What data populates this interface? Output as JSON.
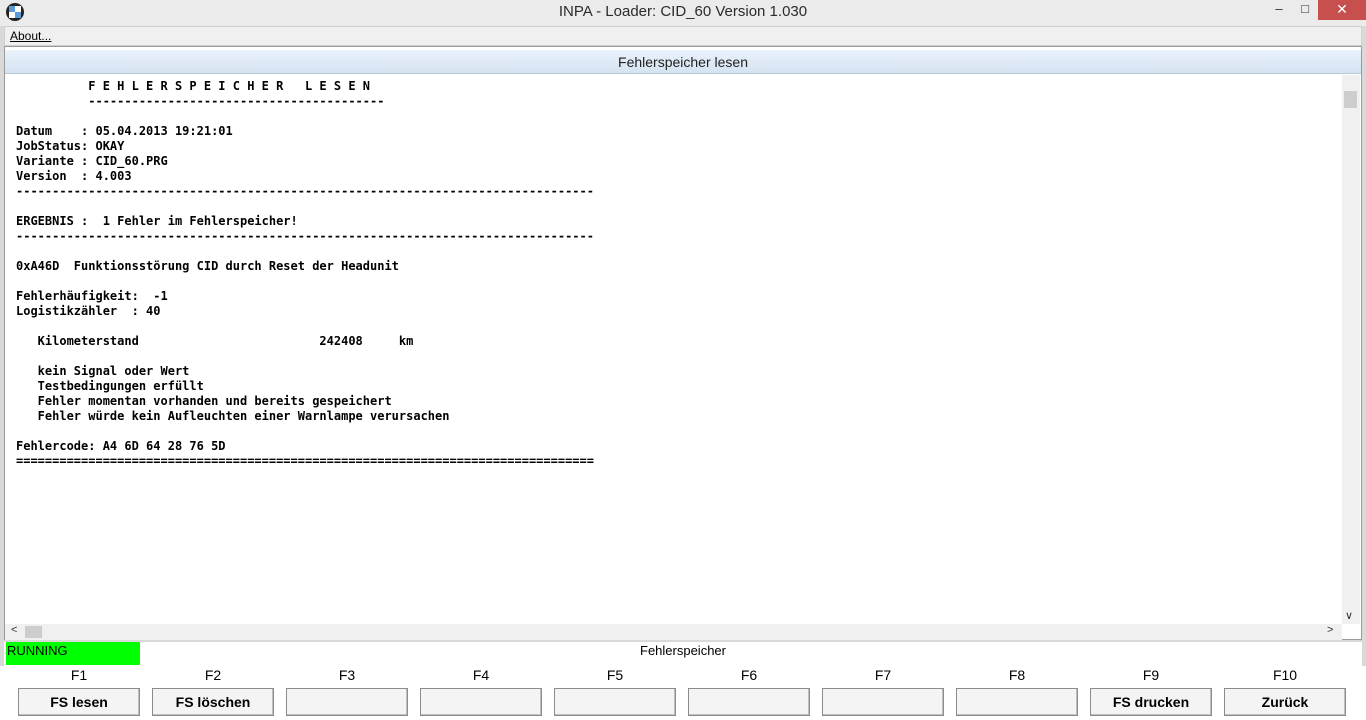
{
  "window": {
    "title": "INPA - Loader:  CID_60 Version 1.030",
    "minimize_glyph": "–",
    "maximize_glyph": "□",
    "close_glyph": "✕",
    "icon": "bmw-logo-icon"
  },
  "menu": {
    "about_label": "About..."
  },
  "panel": {
    "title": "Fehlerspeicher lesen",
    "output": "          F E H L E R S P E I C H E R   L E S E N\n          -----------------------------------------\n\nDatum    : 05.04.2013 19:21:01\nJobStatus: OKAY\nVariante : CID_60.PRG\nVersion  : 4.003\n--------------------------------------------------------------------------------\n\nERGEBNIS :  1 Fehler im Fehlerspeicher!\n--------------------------------------------------------------------------------\n\n0xA46D  Funktionsstörung CID durch Reset der Headunit\n\nFehlerhäufigkeit:  -1\nLogistikzähler  : 40\n\n   Kilometerstand                         242408     km\n\n   kein Signal oder Wert\n   Testbedingungen erfüllt\n   Fehler momentan vorhanden und bereits gespeichert\n   Fehler würde kein Aufleuchten einer Warnlampe verursachen\n\nFehlercode: A4 6D 64 28 76 5D\n================================================================================"
  },
  "scroll": {
    "down_glyph": "∨",
    "left_glyph": "<",
    "right_glyph": ">"
  },
  "status": {
    "state": "RUNNING",
    "state_color": "#00ff00",
    "section": "Fehlerspeicher"
  },
  "fkeys": [
    {
      "key": "F1",
      "label": "FS lesen"
    },
    {
      "key": "F2",
      "label": "FS löschen"
    },
    {
      "key": "F3",
      "label": ""
    },
    {
      "key": "F4",
      "label": ""
    },
    {
      "key": "F5",
      "label": ""
    },
    {
      "key": "F6",
      "label": ""
    },
    {
      "key": "F7",
      "label": ""
    },
    {
      "key": "F8",
      "label": ""
    },
    {
      "key": "F9",
      "label": "FS drucken"
    },
    {
      "key": "F10",
      "label": "Zurück"
    }
  ]
}
